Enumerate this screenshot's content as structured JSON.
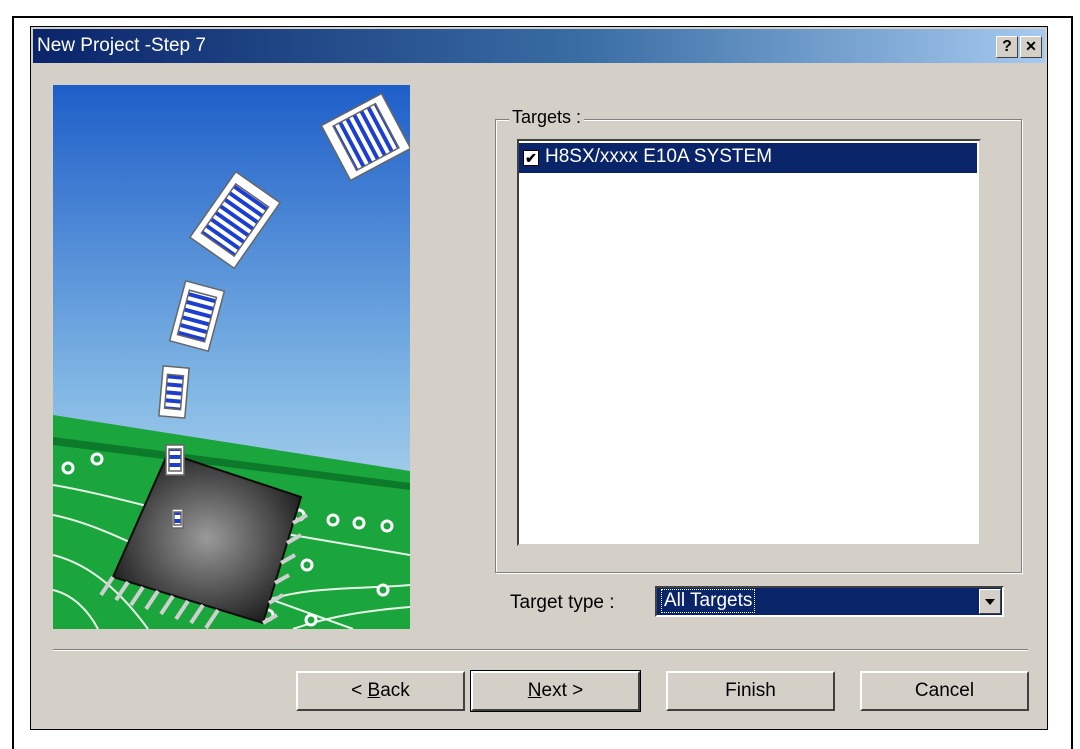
{
  "window": {
    "title": "New Project -Step 7",
    "help_glyph": "?",
    "close_glyph": "✕"
  },
  "targets": {
    "group_label": "Targets :",
    "items": [
      {
        "label": "H8SX/xxxx E10A SYSTEM",
        "checked": true,
        "selected": true
      }
    ]
  },
  "target_type": {
    "label": "Target type :",
    "value": "All Targets"
  },
  "buttons": {
    "back_prefix": "< ",
    "back_key": "B",
    "back_rest": "ack",
    "next_key": "N",
    "next_rest": "ext >",
    "finish": "Finish",
    "cancel": "Cancel"
  },
  "checkbox_glyph": "✔",
  "colors": {
    "selection": "#0a246a",
    "face": "#d4d0c8",
    "title_start": "#0a246a",
    "title_end": "#a6caf0"
  },
  "icons": [
    "help-icon",
    "close-icon",
    "dropdown-arrow-icon",
    "checkbox-icon"
  ]
}
